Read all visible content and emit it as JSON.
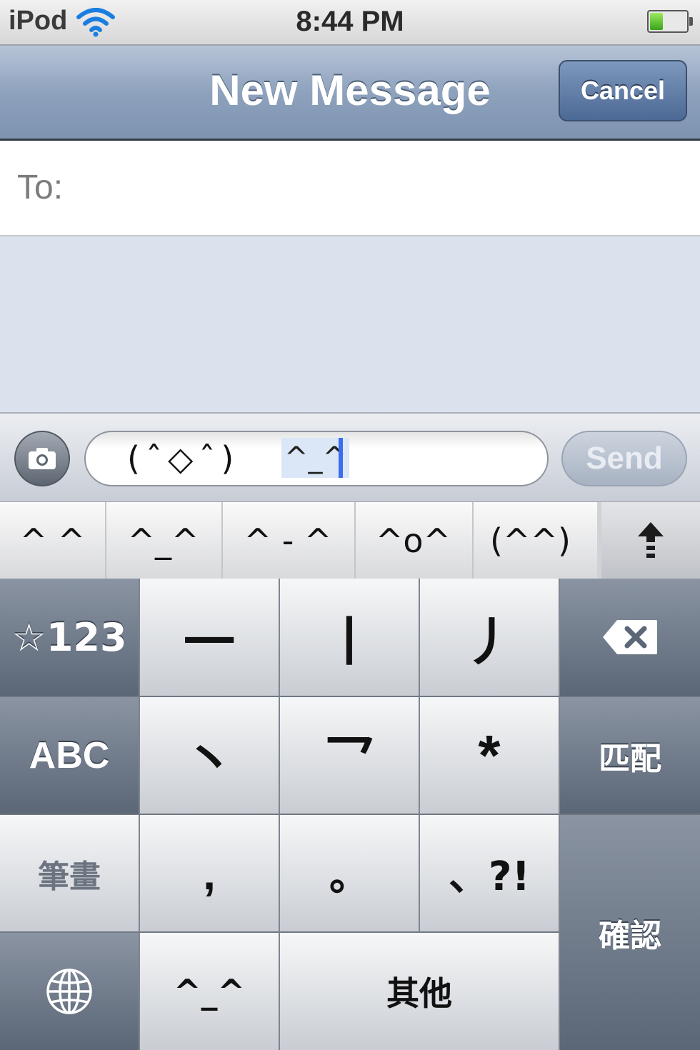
{
  "status_bar": {
    "carrier": "iPod",
    "wifi_icon": "wifi-icon",
    "time": "8:44 PM",
    "battery_icon": "battery-icon",
    "battery_level": 0.35
  },
  "nav_bar": {
    "title": "New Message",
    "cancel_label": "Cancel"
  },
  "recipient": {
    "label": "To:",
    "value": ""
  },
  "compose": {
    "camera_icon": "camera-icon",
    "committed_text": "(ˆ◇ˆ)",
    "marked_text": "^_^",
    "send_label": "Send",
    "send_enabled": false
  },
  "candidates": {
    "items": [
      "^ ^",
      "^_^",
      "^ - ^",
      "^o^",
      "(^^)"
    ],
    "expand_icon": "arrow-up-icon"
  },
  "keyboard": {
    "layout": "Chinese (Traditional) Stroke",
    "keys": {
      "numbers": "☆123",
      "stroke_horizontal": "一",
      "stroke_vertical": "丨",
      "stroke_falling_left": "丿",
      "delete_icon": "delete-icon",
      "abc": "ABC",
      "stroke_dot": "丶",
      "stroke_turning": "乛",
      "wildcard": "*",
      "match": "匹配",
      "strokes": "筆畫",
      "comma": ",",
      "period": "。",
      "punctuation": "、?!",
      "confirm": "確認",
      "globe_icon": "globe-icon",
      "emoticon": "^_^",
      "other": "其他"
    }
  },
  "colors": {
    "nav_bar": "#8ea2bd",
    "cancel_button": "#4c6995",
    "caret": "#3c6dea",
    "keyboard_dark_key": "#5b6676",
    "keyboard_light_key": "#f6f7f8"
  }
}
